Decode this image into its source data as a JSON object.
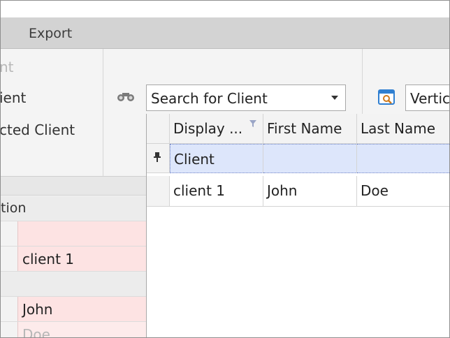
{
  "menu": {
    "export": "Export"
  },
  "ribbon": {
    "items": [
      "nt",
      "ient",
      "cted Client"
    ],
    "search_combo": {
      "value": "Search for Client"
    },
    "vertical_combo": {
      "value": "Vertic"
    }
  },
  "property_panel": {
    "header": "tion",
    "rows": [
      {
        "value": ""
      },
      {
        "value": "client 1"
      },
      {
        "value": ""
      },
      {
        "value": "John"
      },
      {
        "value": "Doe"
      }
    ]
  },
  "grid": {
    "columns": [
      "Display ...",
      "First Name",
      "Last Name"
    ],
    "filter_row": {
      "display": "Client",
      "first": "",
      "last": ""
    },
    "rows": [
      {
        "display": "client 1",
        "first": "John",
        "last": "Doe"
      }
    ]
  },
  "colors": {
    "filter_row": "#dde6fb",
    "highlight_value": "#fde3e3"
  }
}
